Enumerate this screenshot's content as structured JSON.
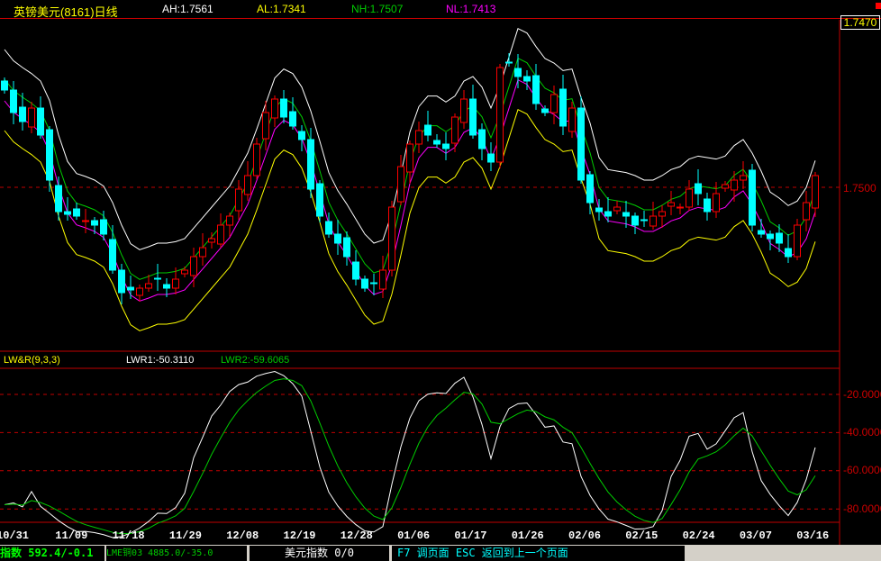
{
  "header": {
    "title": "英镑美元(8161)日线",
    "ah": "AH:1.7561",
    "al": "AL:1.7341",
    "nh": "NH:1.7507",
    "nl": "NL:1.7413"
  },
  "axis": {
    "current_price": "1.7470",
    "price_tick": "1.7500",
    "sub_ticks": [
      "-20.0000",
      "-40.0000",
      "-60.0000",
      "-80.0000"
    ]
  },
  "indicator": {
    "name": "LW&R(9,3,3)",
    "lwr1": "LWR1:-50.3110",
    "lwr2": "LWR2:-59.6065"
  },
  "colors": {
    "up": "#ff0000",
    "down": "#00ffff",
    "grid": "#c00000",
    "ah": "#ffffff",
    "al": "#ffff00",
    "nh": "#00cc00",
    "nl": "#ff00ff"
  },
  "status": {
    "index": "指数 592.4/-0.1",
    "lme": "LME铜03  4885.0/-35.0",
    "usd": "美元指数 0/0",
    "keys": "F7 调页面   ESC 返回到上一个页面"
  },
  "chart_data": {
    "type": "candlestick",
    "title": "英镑美元(8161)日线",
    "x_ticks": [
      "10/31",
      "11/09",
      "11/18",
      "11/29",
      "12/08",
      "12/19",
      "12/28",
      "01/06",
      "01/17",
      "01/26",
      "02/06",
      "02/15",
      "02/24",
      "03/07",
      "03/16"
    ],
    "y_tick": 1.75,
    "closes": [
      1.7608,
      1.7583,
      1.7573,
      1.7588,
      1.7558,
      1.7508,
      1.7473,
      1.747,
      1.7468,
      1.7463,
      1.7458,
      1.7448,
      1.7408,
      1.7383,
      1.7386,
      1.7388,
      1.7393,
      1.7398,
      1.7388,
      1.7398,
      1.7408,
      1.7423,
      1.7433,
      1.7443,
      1.7458,
      1.7468,
      1.7498,
      1.7513,
      1.7548,
      1.7583,
      1.7598,
      1.7578,
      1.7568,
      1.7553,
      1.7498,
      1.7468,
      1.7448,
      1.7438,
      1.7423,
      1.7398,
      1.7388,
      1.7393,
      1.7408,
      1.7478,
      1.7523,
      1.7548,
      1.7563,
      1.7558,
      1.7548,
      1.7543,
      1.7578,
      1.7598,
      1.7558,
      1.7543,
      1.7528,
      1.7633,
      1.7638,
      1.7623,
      1.7618,
      1.7593,
      1.7583,
      1.7603,
      1.7568,
      1.7588,
      1.7508,
      1.7483,
      1.7473,
      1.7468,
      1.7478,
      1.7468,
      1.7458,
      1.7463,
      1.7468,
      1.7473,
      1.7483,
      1.7478,
      1.7498,
      1.7493,
      1.7473,
      1.7493,
      1.7503,
      1.7508,
      1.7513,
      1.7458,
      1.7448,
      1.7443,
      1.7438,
      1.7423,
      1.7458,
      1.7483,
      1.7513
    ],
    "indicator_ticks": [
      -20,
      -40,
      -60,
      -80
    ]
  }
}
